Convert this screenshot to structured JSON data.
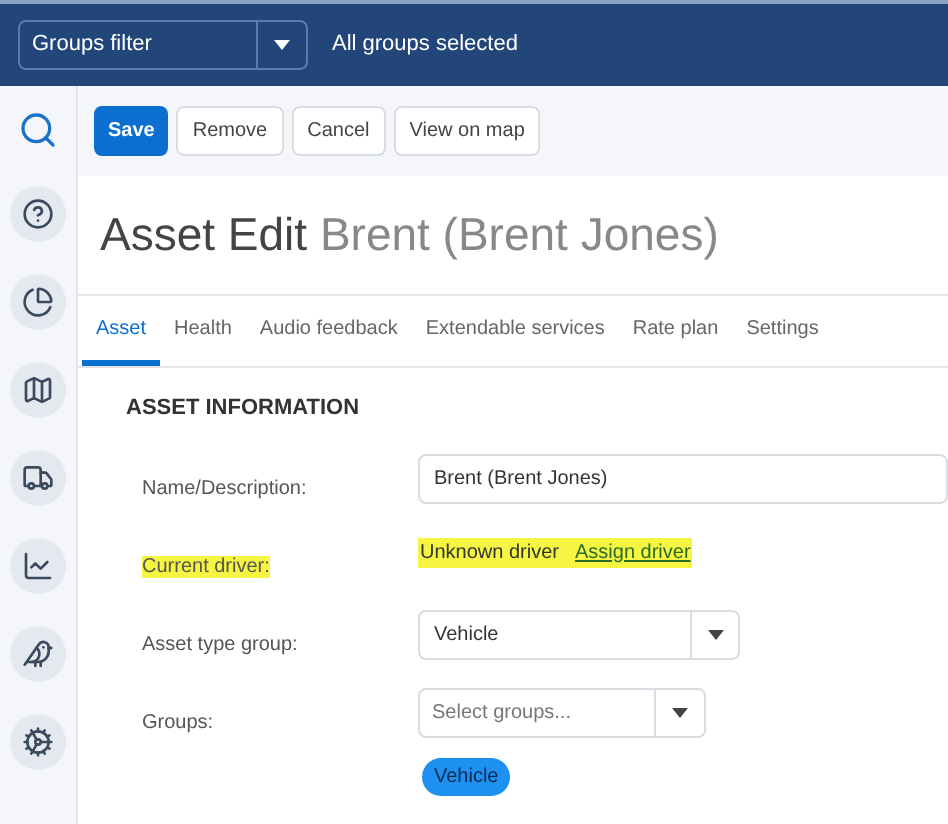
{
  "top_bar": {
    "groups_filter": {
      "value": "Groups filter"
    },
    "status": "All groups selected"
  },
  "toolbar": {
    "buttons": [
      {
        "label": "Save",
        "kind": "primary"
      },
      {
        "label": "Remove",
        "kind": "default"
      },
      {
        "label": "Cancel",
        "kind": "default"
      },
      {
        "label": "View on map",
        "kind": "default"
      }
    ]
  },
  "title": {
    "prefix": "Asset Edit",
    "name": "Brent (Brent Jones)"
  },
  "tabs": [
    {
      "label": "Asset",
      "selected": true
    },
    {
      "label": "Health",
      "selected": false
    },
    {
      "label": "Audio feedback",
      "selected": false
    },
    {
      "label": "Extendable services",
      "selected": false
    },
    {
      "label": "Rate plan",
      "selected": false
    },
    {
      "label": "Settings",
      "selected": false
    }
  ],
  "section": {
    "heading": "ASSET INFORMATION",
    "fields": [
      {
        "kind": "text",
        "label": "Name/Description:",
        "value": "Brent (Brent Jones)",
        "highlighted": false
      },
      {
        "kind": "link",
        "label": "Current driver",
        "label_suffix": ":",
        "value": "Unknown driver",
        "link": "Assign driver",
        "highlighted": true
      },
      {
        "kind": "select",
        "label": "Asset type group:",
        "value": "Vehicle",
        "highlighted": false
      },
      {
        "kind": "multiselect",
        "label": "Groups:",
        "placeholder": "Select groups...",
        "chips": [
          "Vehicle"
        ],
        "highlighted": false
      }
    ]
  }
}
